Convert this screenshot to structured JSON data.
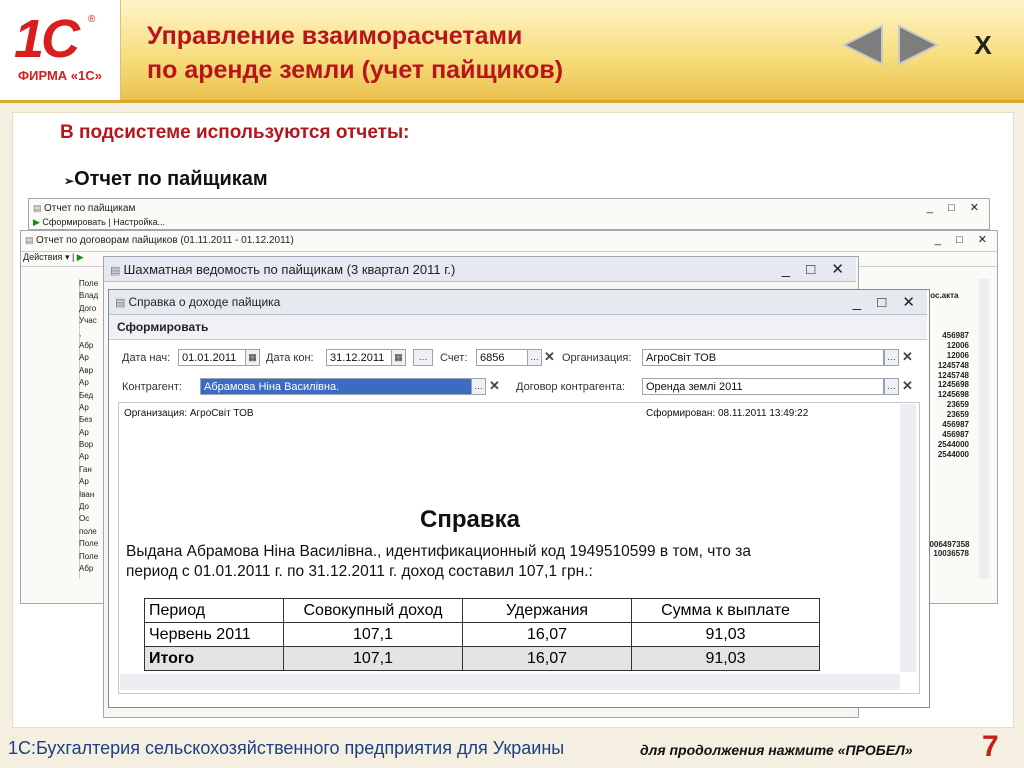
{
  "logo": {
    "mark": "1С",
    "reg": "®",
    "text": "ФИРМА «1С»"
  },
  "header": {
    "title_line1": "Управление взаиморасчетами",
    "title_line2": "по аренде земли (учет пайщиков)",
    "close": "X"
  },
  "subtitle": "В подсистеме используются отчеты:",
  "bullet": {
    "marker": "➢",
    "text": "Отчет по пайщикам"
  },
  "window1": {
    "title": "Отчет по пайщикам",
    "action_run": "Сформировать",
    "action_settings": "Настройка...",
    "buttons": "_ □ ✕"
  },
  "window2": {
    "title": "Отчет по договорам пайщиков (01.11.2011 - 01.12.2011)",
    "menu_actions": "Действия",
    "buttons": "_ □ ✕",
    "left_col": [
      "Поле",
      "Влад",
      "Дого",
      "Учас",
      ",",
      "Абр",
      "Ар",
      "Авр",
      "Ар",
      "Бед",
      "Ар",
      "Без",
      "Ар",
      "Вор",
      "Ар",
      "Ган",
      "Ар",
      "Іван",
      "До",
      "Ос",
      "поле",
      "Поле",
      "Поле",
      "Абр"
    ],
    "right_header": "гос.акта",
    "numbers": [
      "456987",
      "12006",
      "12006",
      "1245748",
      "1245748",
      "1245698",
      "1245698",
      "23659",
      "23659",
      "456987",
      "456987",
      "2544000",
      "2544000",
      "1006497358",
      "10036578"
    ]
  },
  "window3": {
    "title": "Шахматная ведомость по пайщикам (3 квартал 2011 г.)",
    "buttons": "_ □ ✕"
  },
  "window4": {
    "title": "Справка о доходе пайщика",
    "buttons": "_ □ ✕",
    "toolbar_run": "Сформировать",
    "form": {
      "date_start_label": "Дата нач:",
      "date_start": "01.01.2011",
      "date_end_label": "Дата кон:",
      "date_end": "31.12.2011",
      "account_label": "Счет:",
      "account": "6856",
      "org_label": "Организация:",
      "org": "АгроСвіт ТОВ",
      "contractor_label": "Контрагент:",
      "contractor": "Абрамова Ніна Василівна.",
      "contract_label": "Договор контрагента:",
      "contract": "Оренда землі 2011"
    },
    "report": {
      "org_line": "Организация: АгроСвіт ТОВ",
      "generated": "Сформирован: 08.11.2011 13:49:22",
      "heading": "Справка",
      "text_line1": "Выдана Абрамова Ніна Василівна.,   идентификационный код 1949510599 в том, что за",
      "text_line2": "период с 01.01.2011 г. по 31.12.2011 г. доход составил  107,1 грн.:",
      "table": {
        "headers": [
          "Период",
          "Совокупный доход",
          "Удержания",
          "Сумма к выплате"
        ],
        "rows": [
          [
            "Червень  2011",
            "107,1",
            "16,07",
            "91,03"
          ],
          [
            "Итого",
            "107,1",
            "16,07",
            "91,03"
          ]
        ]
      }
    }
  },
  "footer": {
    "text": "1С:Бухгалтерия сельскохозяйственного предприятия для Украины",
    "hint": "для продолжения нажмите «ПРОБЕЛ»",
    "page": "7"
  },
  "colors": {
    "accent": "#b8141e",
    "footer_blue": "#1d3f86",
    "header_gold": "#f7dc7a"
  }
}
